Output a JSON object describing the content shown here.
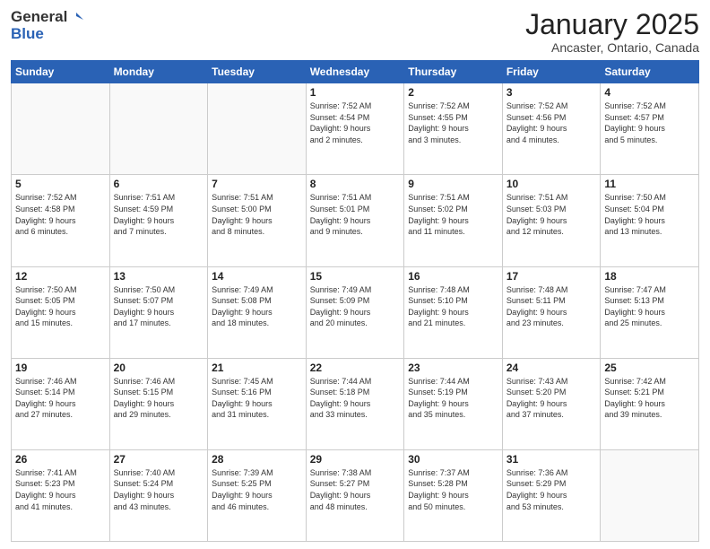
{
  "header": {
    "logo_general": "General",
    "logo_blue": "Blue",
    "month_title": "January 2025",
    "location": "Ancaster, Ontario, Canada"
  },
  "calendar": {
    "weekdays": [
      "Sunday",
      "Monday",
      "Tuesday",
      "Wednesday",
      "Thursday",
      "Friday",
      "Saturday"
    ],
    "weeks": [
      [
        {
          "day": "",
          "detail": ""
        },
        {
          "day": "",
          "detail": ""
        },
        {
          "day": "",
          "detail": ""
        },
        {
          "day": "1",
          "detail": "Sunrise: 7:52 AM\nSunset: 4:54 PM\nDaylight: 9 hours\nand 2 minutes."
        },
        {
          "day": "2",
          "detail": "Sunrise: 7:52 AM\nSunset: 4:55 PM\nDaylight: 9 hours\nand 3 minutes."
        },
        {
          "day": "3",
          "detail": "Sunrise: 7:52 AM\nSunset: 4:56 PM\nDaylight: 9 hours\nand 4 minutes."
        },
        {
          "day": "4",
          "detail": "Sunrise: 7:52 AM\nSunset: 4:57 PM\nDaylight: 9 hours\nand 5 minutes."
        }
      ],
      [
        {
          "day": "5",
          "detail": "Sunrise: 7:52 AM\nSunset: 4:58 PM\nDaylight: 9 hours\nand 6 minutes."
        },
        {
          "day": "6",
          "detail": "Sunrise: 7:51 AM\nSunset: 4:59 PM\nDaylight: 9 hours\nand 7 minutes."
        },
        {
          "day": "7",
          "detail": "Sunrise: 7:51 AM\nSunset: 5:00 PM\nDaylight: 9 hours\nand 8 minutes."
        },
        {
          "day": "8",
          "detail": "Sunrise: 7:51 AM\nSunset: 5:01 PM\nDaylight: 9 hours\nand 9 minutes."
        },
        {
          "day": "9",
          "detail": "Sunrise: 7:51 AM\nSunset: 5:02 PM\nDaylight: 9 hours\nand 11 minutes."
        },
        {
          "day": "10",
          "detail": "Sunrise: 7:51 AM\nSunset: 5:03 PM\nDaylight: 9 hours\nand 12 minutes."
        },
        {
          "day": "11",
          "detail": "Sunrise: 7:50 AM\nSunset: 5:04 PM\nDaylight: 9 hours\nand 13 minutes."
        }
      ],
      [
        {
          "day": "12",
          "detail": "Sunrise: 7:50 AM\nSunset: 5:05 PM\nDaylight: 9 hours\nand 15 minutes."
        },
        {
          "day": "13",
          "detail": "Sunrise: 7:50 AM\nSunset: 5:07 PM\nDaylight: 9 hours\nand 17 minutes."
        },
        {
          "day": "14",
          "detail": "Sunrise: 7:49 AM\nSunset: 5:08 PM\nDaylight: 9 hours\nand 18 minutes."
        },
        {
          "day": "15",
          "detail": "Sunrise: 7:49 AM\nSunset: 5:09 PM\nDaylight: 9 hours\nand 20 minutes."
        },
        {
          "day": "16",
          "detail": "Sunrise: 7:48 AM\nSunset: 5:10 PM\nDaylight: 9 hours\nand 21 minutes."
        },
        {
          "day": "17",
          "detail": "Sunrise: 7:48 AM\nSunset: 5:11 PM\nDaylight: 9 hours\nand 23 minutes."
        },
        {
          "day": "18",
          "detail": "Sunrise: 7:47 AM\nSunset: 5:13 PM\nDaylight: 9 hours\nand 25 minutes."
        }
      ],
      [
        {
          "day": "19",
          "detail": "Sunrise: 7:46 AM\nSunset: 5:14 PM\nDaylight: 9 hours\nand 27 minutes."
        },
        {
          "day": "20",
          "detail": "Sunrise: 7:46 AM\nSunset: 5:15 PM\nDaylight: 9 hours\nand 29 minutes."
        },
        {
          "day": "21",
          "detail": "Sunrise: 7:45 AM\nSunset: 5:16 PM\nDaylight: 9 hours\nand 31 minutes."
        },
        {
          "day": "22",
          "detail": "Sunrise: 7:44 AM\nSunset: 5:18 PM\nDaylight: 9 hours\nand 33 minutes."
        },
        {
          "day": "23",
          "detail": "Sunrise: 7:44 AM\nSunset: 5:19 PM\nDaylight: 9 hours\nand 35 minutes."
        },
        {
          "day": "24",
          "detail": "Sunrise: 7:43 AM\nSunset: 5:20 PM\nDaylight: 9 hours\nand 37 minutes."
        },
        {
          "day": "25",
          "detail": "Sunrise: 7:42 AM\nSunset: 5:21 PM\nDaylight: 9 hours\nand 39 minutes."
        }
      ],
      [
        {
          "day": "26",
          "detail": "Sunrise: 7:41 AM\nSunset: 5:23 PM\nDaylight: 9 hours\nand 41 minutes."
        },
        {
          "day": "27",
          "detail": "Sunrise: 7:40 AM\nSunset: 5:24 PM\nDaylight: 9 hours\nand 43 minutes."
        },
        {
          "day": "28",
          "detail": "Sunrise: 7:39 AM\nSunset: 5:25 PM\nDaylight: 9 hours\nand 46 minutes."
        },
        {
          "day": "29",
          "detail": "Sunrise: 7:38 AM\nSunset: 5:27 PM\nDaylight: 9 hours\nand 48 minutes."
        },
        {
          "day": "30",
          "detail": "Sunrise: 7:37 AM\nSunset: 5:28 PM\nDaylight: 9 hours\nand 50 minutes."
        },
        {
          "day": "31",
          "detail": "Sunrise: 7:36 AM\nSunset: 5:29 PM\nDaylight: 9 hours\nand 53 minutes."
        },
        {
          "day": "",
          "detail": ""
        }
      ]
    ]
  }
}
